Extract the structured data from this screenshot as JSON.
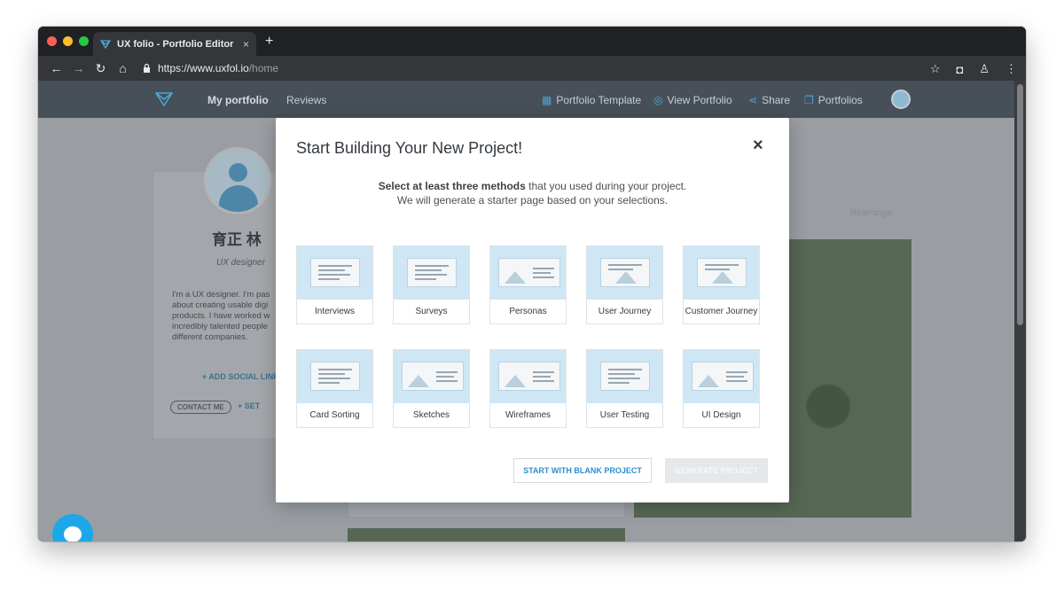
{
  "browser": {
    "tab_title": "UX folio - Portfolio Editor",
    "tab_close": "×",
    "new_tab": "+",
    "url_host": "https://www.uxfol.io",
    "url_path": "/home"
  },
  "site_nav": {
    "my_portfolio": "My portfolio",
    "reviews": "Reviews",
    "portfolio_template": "Portfolio Template",
    "view_portfolio": "View Portfolio",
    "share": "Share",
    "portfolios": "Portfolios"
  },
  "profile": {
    "name": "育正 林",
    "role": "UX designer",
    "bio": "I'm a UX designer. I'm pas about creating usable digi products. I have worked w incredibly talented people different companies.",
    "add_social": "+ ADD SOCIAL LINK",
    "contact": "CONTACT ME",
    "set": "+ SET"
  },
  "rearrange": "Rearrange",
  "modal": {
    "title": "Start Building Your New Project!",
    "close": "×",
    "subtitle_bold": "Select at least three methods",
    "subtitle_rest": " that you used during your project.",
    "subtitle_line2": "We will generate a starter page based on your selections.",
    "methods": [
      {
        "label": "Interviews"
      },
      {
        "label": "Surveys"
      },
      {
        "label": "Personas"
      },
      {
        "label": "User Journey"
      },
      {
        "label": "Customer Journey"
      },
      {
        "label": "Card Sorting"
      },
      {
        "label": "Sketches"
      },
      {
        "label": "Wireframes"
      },
      {
        "label": "User Testing"
      },
      {
        "label": "UI Design"
      }
    ],
    "blank_button": "START WITH BLANK PROJECT",
    "generate_button": "GENERATE PROJECT"
  },
  "colors": {
    "accent": "#2c8fcd",
    "chat": "#1ea7e8",
    "thumb_bg": "#cfe6f5"
  }
}
